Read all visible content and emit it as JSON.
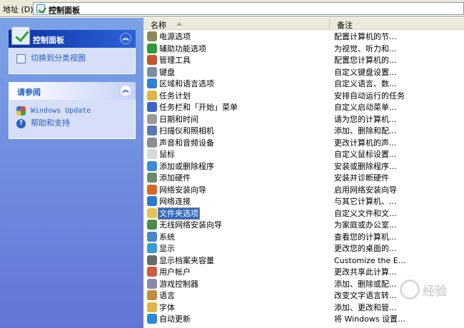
{
  "address_bar": {
    "label": "地址 (D)",
    "path": "控制面板"
  },
  "task_pane": {
    "control_panel": {
      "title": "控制面板",
      "switch_view": "切换到分类视图"
    },
    "see_also": {
      "title": "请参阅",
      "links": [
        "Windows Update",
        "帮助和支持"
      ]
    }
  },
  "columns": {
    "name": "名称",
    "comment": "备注"
  },
  "items": [
    {
      "name": "电源选项",
      "desc": "配置计算机的节...",
      "icon": "power-icon",
      "color": "#8a8a5c"
    },
    {
      "name": "辅助功能选项",
      "desc": "为视觉、听力和...",
      "icon": "accessibility-icon",
      "color": "#2e9a3a"
    },
    {
      "name": "管理工具",
      "desc": "配置您计算机的...",
      "icon": "admin-tools-icon",
      "color": "#c5542a"
    },
    {
      "name": "键盘",
      "desc": "自定义键盘设置...",
      "icon": "keyboard-icon",
      "color": "#7d8ca6"
    },
    {
      "name": "区域和语言选项",
      "desc": "自定义语言、数...",
      "icon": "globe-icon",
      "color": "#2f7fd6"
    },
    {
      "name": "任务计划",
      "desc": "安排自动运行的任务",
      "icon": "scheduled-tasks-icon",
      "color": "#e2b545"
    },
    {
      "name": "任务栏和「开始」菜单",
      "desc": "自定义启动菜单...",
      "icon": "taskbar-icon",
      "color": "#3a66c8"
    },
    {
      "name": "日期和时间",
      "desc": "请为您的计算机...",
      "icon": "clock-icon",
      "color": "#9a9a9a"
    },
    {
      "name": "扫描仪和照相机",
      "desc": "添加、删除和配...",
      "icon": "scanner-icon",
      "color": "#5c78b3"
    },
    {
      "name": "声音和音频设备",
      "desc": "更改计算机的声...",
      "icon": "speaker-icon",
      "color": "#8d8d8d"
    },
    {
      "name": "鼠标",
      "desc": "自定义鼠标设置...",
      "icon": "mouse-icon",
      "color": "#d8d8d8"
    },
    {
      "name": "添加或删除程序",
      "desc": "安装或删除程序...",
      "icon": "add-remove-icon",
      "color": "#3b8ad8"
    },
    {
      "name": "添加硬件",
      "desc": "安装并诊断硬件",
      "icon": "hardware-icon",
      "color": "#6b8b6b"
    },
    {
      "name": "网络安装向导",
      "desc": "启用网络安装向导",
      "icon": "network-wizard-icon",
      "color": "#d8662a"
    },
    {
      "name": "网络连接",
      "desc": "与其它计算机、...",
      "icon": "network-icon",
      "color": "#2a7ad0"
    },
    {
      "name": "文件夹选项",
      "desc": "自定义文件和文...",
      "icon": "folder-options-icon",
      "color": "#e6c25a"
    },
    {
      "name": "无线网络安装向导",
      "desc": "为家庭或办公室...",
      "icon": "wireless-icon",
      "color": "#4c8a4c"
    },
    {
      "name": "系统",
      "desc": "查看您的计算机...",
      "icon": "system-icon",
      "color": "#4a86c5"
    },
    {
      "name": "显示",
      "desc": "更改您的桌面的...",
      "icon": "display-icon",
      "color": "#3a9ad6"
    },
    {
      "name": "显示档案夹容量",
      "desc": "Customize the E...",
      "icon": "folder-size-icon",
      "color": "#6a6a6a"
    },
    {
      "name": "用户帐户",
      "desc": "更改共享此计算...",
      "icon": "users-icon",
      "color": "#d05a3a"
    },
    {
      "name": "游戏控制器",
      "desc": "添加、删除或配...",
      "icon": "gamepad-icon",
      "color": "#8a8aa6"
    },
    {
      "name": "语言",
      "desc": "改变文字语言转...",
      "icon": "language-icon",
      "color": "#c58a3a"
    },
    {
      "name": "字体",
      "desc": "添加、更改和管...",
      "icon": "fonts-icon",
      "color": "#e2b545"
    },
    {
      "name": "自动更新",
      "desc": "将 Windows 设置...",
      "icon": "windows-update-icon",
      "color": "#2a8ad6"
    }
  ],
  "selected_item": "文件夹选项",
  "watermark": "经验"
}
